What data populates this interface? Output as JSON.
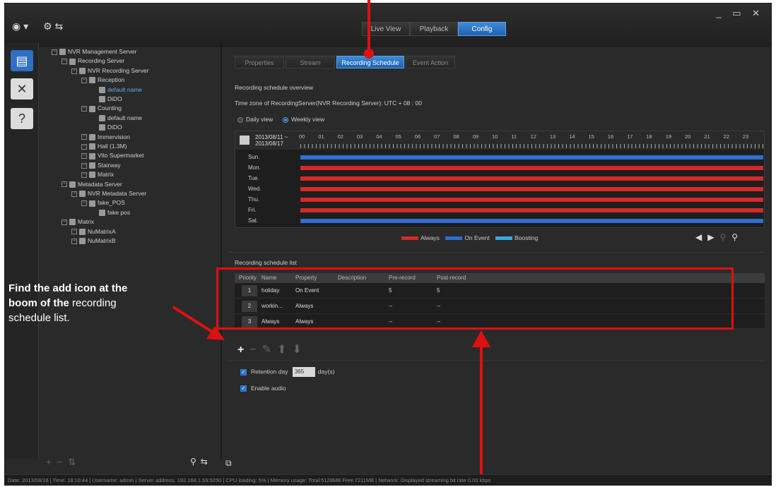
{
  "titlebar": {
    "tabs": [
      {
        "label": "Live View",
        "active": false
      },
      {
        "label": "Playback",
        "active": false
      },
      {
        "label": "Config",
        "active": true
      }
    ],
    "window_controls": "_ ▭ ✕"
  },
  "rail": {
    "icons": [
      "server-icon",
      "tools-icon",
      "help-icon"
    ]
  },
  "tree": {
    "items": [
      {
        "label": "NVR Management Server",
        "level": 0
      },
      {
        "label": "Recording Server",
        "level": 1
      },
      {
        "label": "NVR Recording Server",
        "level": 2
      },
      {
        "label": "Reception",
        "level": 3
      },
      {
        "label": "default name",
        "level": 4,
        "selected": true
      },
      {
        "label": "DiDO",
        "level": 4
      },
      {
        "label": "Counting",
        "level": 3
      },
      {
        "label": "default name",
        "level": 4
      },
      {
        "label": "DiDO",
        "level": 4
      },
      {
        "label": "Immervision",
        "level": 3
      },
      {
        "label": "Hall (1.3M)",
        "level": 3
      },
      {
        "label": "Vito Supermarket",
        "level": 3
      },
      {
        "label": "Stairway",
        "level": 3
      },
      {
        "label": "Matrix",
        "level": 3
      },
      {
        "label": "Metadata Server",
        "level": 1
      },
      {
        "label": "NVR Metadata Server",
        "level": 2
      },
      {
        "label": "fake_POS",
        "level": 3
      },
      {
        "label": "fake pos",
        "level": 4
      },
      {
        "label": "Matrix",
        "level": 1
      },
      {
        "label": "NuMatrixA",
        "level": 2
      },
      {
        "label": "NuMatrixB",
        "level": 2
      }
    ]
  },
  "config": {
    "subtabs": [
      {
        "label": "Properties",
        "active": false
      },
      {
        "label": "Stream",
        "active": false
      },
      {
        "label": "Recording Schedule",
        "active": true
      },
      {
        "label": "Event Action",
        "active": false
      }
    ],
    "overview_title": "Recording schedule overview",
    "timezone": "Time zone of RecordingServer(NVR Recording Server): UTC + 08 : 00",
    "view_daily": "Daily view",
    "view_weekly": "Weekly view",
    "date_from": "2013/08/11 ~",
    "date_to": "2013/08/17",
    "hours": [
      "00",
      "01",
      "02",
      "03",
      "04",
      "05",
      "06",
      "07",
      "08",
      "09",
      "10",
      "11",
      "12",
      "13",
      "14",
      "15",
      "16",
      "17",
      "18",
      "19",
      "20",
      "21",
      "22",
      "23"
    ],
    "days": [
      {
        "label": "Sun.",
        "mode": "on_event"
      },
      {
        "label": "Mon.",
        "mode": "always"
      },
      {
        "label": "Tue.",
        "mode": "always"
      },
      {
        "label": "Wed.",
        "mode": "always"
      },
      {
        "label": "Thu.",
        "mode": "always"
      },
      {
        "label": "Fri.",
        "mode": "always"
      },
      {
        "label": "Sat.",
        "mode": "on_event"
      }
    ],
    "legend": {
      "always": "Always",
      "on_event": "On Event",
      "boosting": "Boosting"
    },
    "colors": {
      "always": "#d42a2a",
      "on_event": "#2e6fd0",
      "boosting": "#3aa6e0",
      "annotation": "#e01010"
    },
    "list_title": "Recording schedule list",
    "list_headers": [
      "Priority",
      "Name",
      "Property",
      "Description",
      "Pre-record",
      "Post-record"
    ],
    "list_rows": [
      {
        "priority": "1",
        "name": "holiday",
        "property": "On Event",
        "description": "",
        "pre": "5",
        "post": "5"
      },
      {
        "priority": "2",
        "name": "workin...",
        "property": "Always",
        "description": "",
        "pre": "--",
        "post": "--"
      },
      {
        "priority": "3",
        "name": "Always",
        "property": "Always",
        "description": "",
        "pre": "--",
        "post": "--"
      }
    ],
    "retention_label": "Retention day",
    "retention_value": "365",
    "retention_unit": "day(s)",
    "enable_audio": "Enable audio"
  },
  "statusbar": "Date: 2013/08/16 | Time: 18:10:44 | Username: admin | Server address: 192.168.1.59:5250 | CPU loading: 5% | Memory usage: Total:5128MB Free:7211MB | Network: Displayed streaming bit rate    0.00 kbps",
  "annotation": {
    "line1": "Find the add icon at the",
    "line2": "boom of the",
    "line2b": "recording",
    "line3": "schedule list."
  }
}
